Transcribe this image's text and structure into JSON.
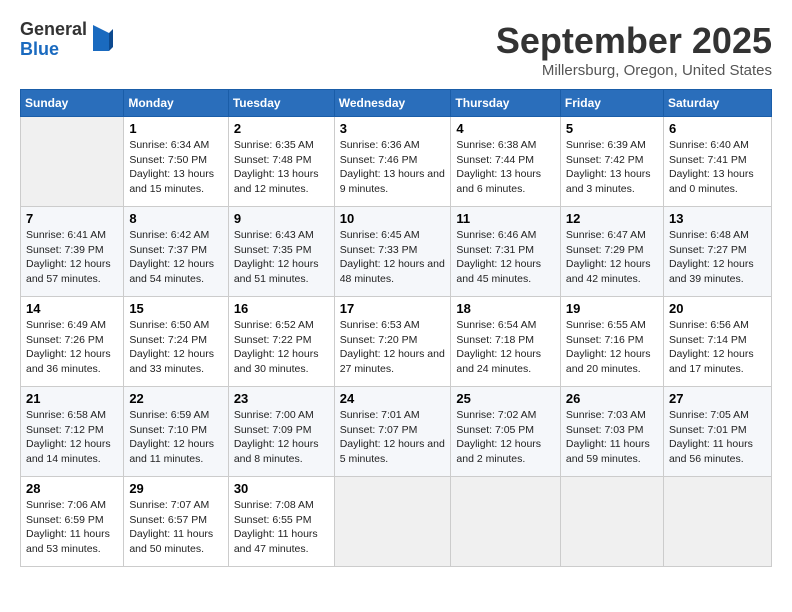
{
  "header": {
    "logo": {
      "general": "General",
      "blue": "Blue"
    },
    "title": "September 2025",
    "location": "Millersburg, Oregon, United States"
  },
  "weekdays": [
    "Sunday",
    "Monday",
    "Tuesday",
    "Wednesday",
    "Thursday",
    "Friday",
    "Saturday"
  ],
  "weeks": [
    [
      null,
      {
        "day": 1,
        "sunrise": "Sunrise: 6:34 AM",
        "sunset": "Sunset: 7:50 PM",
        "daylight": "Daylight: 13 hours and 15 minutes."
      },
      {
        "day": 2,
        "sunrise": "Sunrise: 6:35 AM",
        "sunset": "Sunset: 7:48 PM",
        "daylight": "Daylight: 13 hours and 12 minutes."
      },
      {
        "day": 3,
        "sunrise": "Sunrise: 6:36 AM",
        "sunset": "Sunset: 7:46 PM",
        "daylight": "Daylight: 13 hours and 9 minutes."
      },
      {
        "day": 4,
        "sunrise": "Sunrise: 6:38 AM",
        "sunset": "Sunset: 7:44 PM",
        "daylight": "Daylight: 13 hours and 6 minutes."
      },
      {
        "day": 5,
        "sunrise": "Sunrise: 6:39 AM",
        "sunset": "Sunset: 7:42 PM",
        "daylight": "Daylight: 13 hours and 3 minutes."
      },
      {
        "day": 6,
        "sunrise": "Sunrise: 6:40 AM",
        "sunset": "Sunset: 7:41 PM",
        "daylight": "Daylight: 13 hours and 0 minutes."
      }
    ],
    [
      {
        "day": 7,
        "sunrise": "Sunrise: 6:41 AM",
        "sunset": "Sunset: 7:39 PM",
        "daylight": "Daylight: 12 hours and 57 minutes."
      },
      {
        "day": 8,
        "sunrise": "Sunrise: 6:42 AM",
        "sunset": "Sunset: 7:37 PM",
        "daylight": "Daylight: 12 hours and 54 minutes."
      },
      {
        "day": 9,
        "sunrise": "Sunrise: 6:43 AM",
        "sunset": "Sunset: 7:35 PM",
        "daylight": "Daylight: 12 hours and 51 minutes."
      },
      {
        "day": 10,
        "sunrise": "Sunrise: 6:45 AM",
        "sunset": "Sunset: 7:33 PM",
        "daylight": "Daylight: 12 hours and 48 minutes."
      },
      {
        "day": 11,
        "sunrise": "Sunrise: 6:46 AM",
        "sunset": "Sunset: 7:31 PM",
        "daylight": "Daylight: 12 hours and 45 minutes."
      },
      {
        "day": 12,
        "sunrise": "Sunrise: 6:47 AM",
        "sunset": "Sunset: 7:29 PM",
        "daylight": "Daylight: 12 hours and 42 minutes."
      },
      {
        "day": 13,
        "sunrise": "Sunrise: 6:48 AM",
        "sunset": "Sunset: 7:27 PM",
        "daylight": "Daylight: 12 hours and 39 minutes."
      }
    ],
    [
      {
        "day": 14,
        "sunrise": "Sunrise: 6:49 AM",
        "sunset": "Sunset: 7:26 PM",
        "daylight": "Daylight: 12 hours and 36 minutes."
      },
      {
        "day": 15,
        "sunrise": "Sunrise: 6:50 AM",
        "sunset": "Sunset: 7:24 PM",
        "daylight": "Daylight: 12 hours and 33 minutes."
      },
      {
        "day": 16,
        "sunrise": "Sunrise: 6:52 AM",
        "sunset": "Sunset: 7:22 PM",
        "daylight": "Daylight: 12 hours and 30 minutes."
      },
      {
        "day": 17,
        "sunrise": "Sunrise: 6:53 AM",
        "sunset": "Sunset: 7:20 PM",
        "daylight": "Daylight: 12 hours and 27 minutes."
      },
      {
        "day": 18,
        "sunrise": "Sunrise: 6:54 AM",
        "sunset": "Sunset: 7:18 PM",
        "daylight": "Daylight: 12 hours and 24 minutes."
      },
      {
        "day": 19,
        "sunrise": "Sunrise: 6:55 AM",
        "sunset": "Sunset: 7:16 PM",
        "daylight": "Daylight: 12 hours and 20 minutes."
      },
      {
        "day": 20,
        "sunrise": "Sunrise: 6:56 AM",
        "sunset": "Sunset: 7:14 PM",
        "daylight": "Daylight: 12 hours and 17 minutes."
      }
    ],
    [
      {
        "day": 21,
        "sunrise": "Sunrise: 6:58 AM",
        "sunset": "Sunset: 7:12 PM",
        "daylight": "Daylight: 12 hours and 14 minutes."
      },
      {
        "day": 22,
        "sunrise": "Sunrise: 6:59 AM",
        "sunset": "Sunset: 7:10 PM",
        "daylight": "Daylight: 12 hours and 11 minutes."
      },
      {
        "day": 23,
        "sunrise": "Sunrise: 7:00 AM",
        "sunset": "Sunset: 7:09 PM",
        "daylight": "Daylight: 12 hours and 8 minutes."
      },
      {
        "day": 24,
        "sunrise": "Sunrise: 7:01 AM",
        "sunset": "Sunset: 7:07 PM",
        "daylight": "Daylight: 12 hours and 5 minutes."
      },
      {
        "day": 25,
        "sunrise": "Sunrise: 7:02 AM",
        "sunset": "Sunset: 7:05 PM",
        "daylight": "Daylight: 12 hours and 2 minutes."
      },
      {
        "day": 26,
        "sunrise": "Sunrise: 7:03 AM",
        "sunset": "Sunset: 7:03 PM",
        "daylight": "Daylight: 11 hours and 59 minutes."
      },
      {
        "day": 27,
        "sunrise": "Sunrise: 7:05 AM",
        "sunset": "Sunset: 7:01 PM",
        "daylight": "Daylight: 11 hours and 56 minutes."
      }
    ],
    [
      {
        "day": 28,
        "sunrise": "Sunrise: 7:06 AM",
        "sunset": "Sunset: 6:59 PM",
        "daylight": "Daylight: 11 hours and 53 minutes."
      },
      {
        "day": 29,
        "sunrise": "Sunrise: 7:07 AM",
        "sunset": "Sunset: 6:57 PM",
        "daylight": "Daylight: 11 hours and 50 minutes."
      },
      {
        "day": 30,
        "sunrise": "Sunrise: 7:08 AM",
        "sunset": "Sunset: 6:55 PM",
        "daylight": "Daylight: 11 hours and 47 minutes."
      },
      null,
      null,
      null,
      null
    ]
  ]
}
